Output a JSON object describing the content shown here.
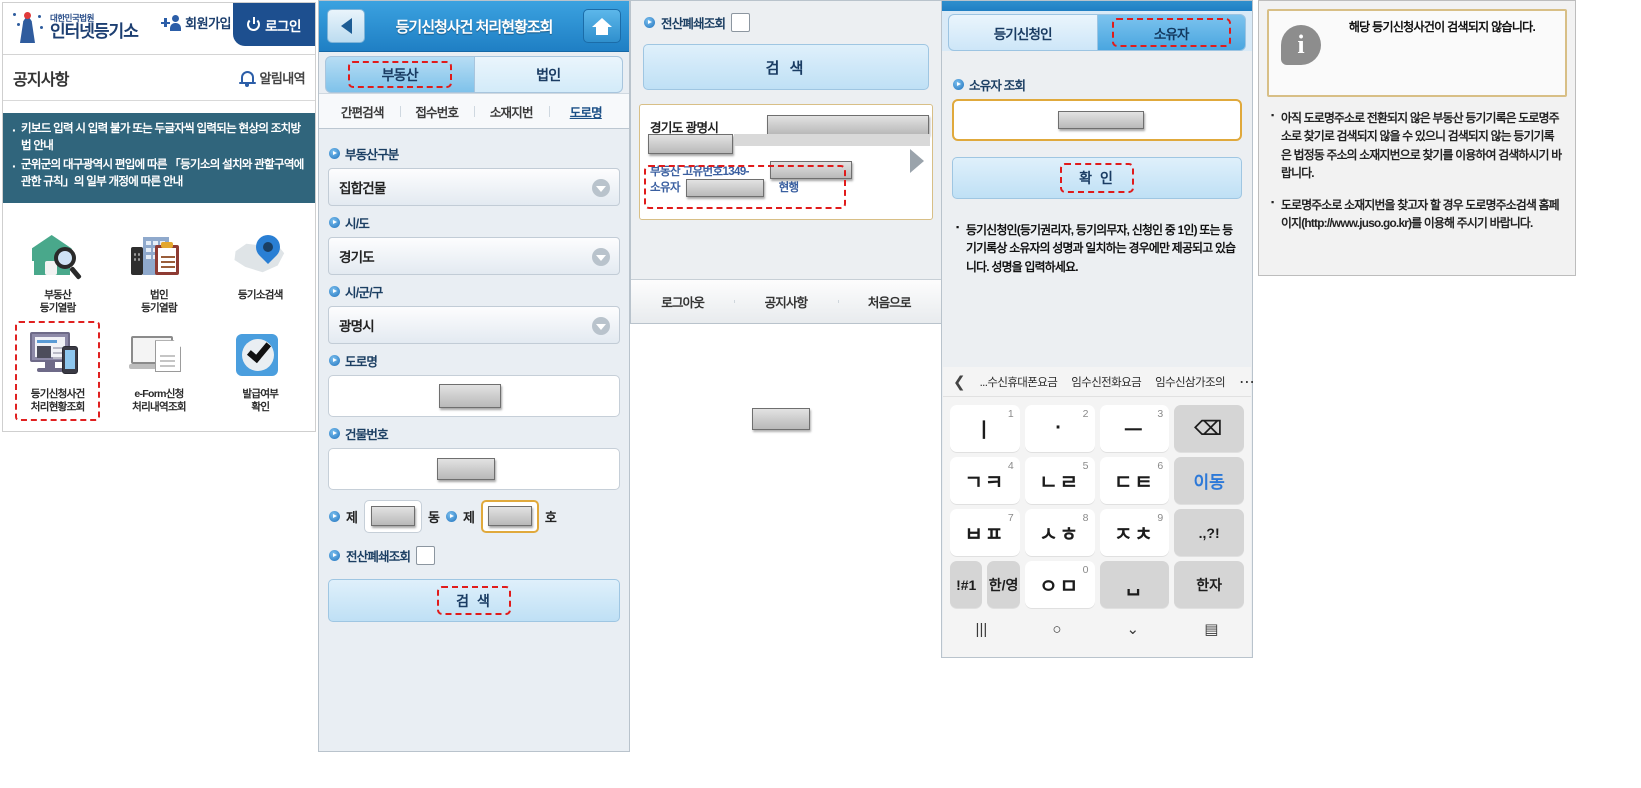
{
  "home": {
    "logo": {
      "line1": "대한민국법원",
      "line2": "인터넷등기소"
    },
    "join_label": "회원가입",
    "login_label": "로그인",
    "notice_title": "공지사항",
    "alarm_label": "알림내역",
    "notices": [
      "키보드 입력 시 입력 불가 또는 두글자씩 입력되는 현상의 조치방법 안내",
      "군위군의 대구광역시 편입에 따른 「등기소의 설치와 관할구역에 관한 규칙」의 일부 개정에 따른 안내"
    ],
    "menu": [
      {
        "label": "부동산\n등기열람",
        "icon": "house-search-icon",
        "highlight": false
      },
      {
        "label": "법인\n등기열람",
        "icon": "building-clipboard-icon",
        "highlight": false
      },
      {
        "label": "등기소검색",
        "icon": "map-pin-icon",
        "highlight": false
      },
      {
        "label": "등기신청사건\n처리현황조회",
        "icon": "desktop-mobile-icon",
        "highlight": true
      },
      {
        "label": "e-Form신청\n처리내역조회",
        "icon": "laptop-document-icon",
        "highlight": false
      },
      {
        "label": "발급여부\n확인",
        "icon": "check-badge-icon",
        "highlight": false
      }
    ]
  },
  "form": {
    "header_title": "등기신청사건 처리현황조회",
    "back_icon": "back-chevron-icon",
    "home_icon": "home-icon",
    "tabs": [
      {
        "label": "부동산",
        "active": true,
        "highlight": true
      },
      {
        "label": "법인",
        "active": false,
        "highlight": false
      }
    ],
    "subtabs": [
      {
        "label": "간편검색",
        "active": false
      },
      {
        "label": "접수번호",
        "active": false
      },
      {
        "label": "소재지번",
        "active": false
      },
      {
        "label": "도로명",
        "active": true
      }
    ],
    "fields": [
      {
        "label": "부동산구분",
        "value": "집합건물",
        "kind": "select"
      },
      {
        "label": "시/도",
        "value": "경기도",
        "kind": "select"
      },
      {
        "label": "시/군/구",
        "value": "광명시",
        "kind": "select"
      },
      {
        "label": "도로명",
        "value": "",
        "kind": "text",
        "redacted": true
      },
      {
        "label": "건물번호",
        "value": "",
        "kind": "text",
        "redacted": true
      }
    ],
    "dong_prefix": "제",
    "dong_suffix": "동",
    "ho_prefix": "제",
    "ho_suffix": "호",
    "closed_label": "전산폐쇄조회",
    "search_label": "검 색"
  },
  "results": {
    "closed_label": "전산폐쇄조회",
    "search_label": "검 색",
    "card": {
      "address_prefix": "경기도 광명시",
      "unique_no_label": "부동산 고유번호",
      "unique_no_value": "1349-",
      "owner_label": "소유자",
      "status_text": "현행",
      "arrow_icon": "chevron-right-icon"
    },
    "footer": [
      "로그아웃",
      "공지사항",
      "처음으로"
    ]
  },
  "owner": {
    "tabs": [
      {
        "label": "등기신청인",
        "active": false,
        "highlight": false
      },
      {
        "label": "소유자",
        "active": true,
        "highlight": true
      }
    ],
    "section_label": "소유자 조회",
    "input_value": "",
    "confirm_label": "확 인",
    "help_text": "등기신청인(등기권리자, 등기의무자, 신청인 중 1인) 또는 등기기록상 소유자의 성명과 일치하는 경우에만 제공되고 있습니다. 성명을 입력하세요.",
    "keyboard": {
      "back_icon": "suggest-back-chevron-icon",
      "more_icon": "suggest-more-icon",
      "suggestions": [
        "...수신휴대폰요금",
        "임수신전화요금",
        "임수신삼가조의"
      ],
      "keys": [
        {
          "main": "ㅣ",
          "num": "1",
          "type": "white"
        },
        {
          "main": "·",
          "num": "2",
          "type": "white"
        },
        {
          "main": "ㅡ",
          "num": "3",
          "type": "white"
        },
        {
          "main": "⌫",
          "num": "",
          "type": "grey",
          "name": "backspace-key"
        },
        {
          "main": "ㄱㅋ",
          "num": "4",
          "type": "white"
        },
        {
          "main": "ㄴㄹ",
          "num": "5",
          "type": "white"
        },
        {
          "main": "ㄷㅌ",
          "num": "6",
          "type": "white"
        },
        {
          "main": "이동",
          "num": "",
          "type": "blue",
          "name": "move-key"
        },
        {
          "main": "ㅂㅍ",
          "num": "7",
          "type": "white"
        },
        {
          "main": "ㅅㅎ",
          "num": "8",
          "type": "white"
        },
        {
          "main": "ㅈㅊ",
          "num": "9",
          "type": "white"
        },
        {
          "main": ".,?!",
          "num": "",
          "type": "grey",
          "name": "punctuation-key"
        },
        {
          "main": "!#1",
          "num": "",
          "type": "grey",
          "name": "symbols-key"
        },
        {
          "main": "한/영",
          "num": "",
          "type": "grey",
          "name": "language-key"
        },
        {
          "main": "ㅇㅁ",
          "num": "0",
          "type": "white"
        },
        {
          "main": "␣",
          "num": "",
          "type": "grey",
          "name": "space-key"
        },
        {
          "main": "한자",
          "num": "",
          "type": "grey",
          "name": "hanja-key"
        }
      ],
      "nav": [
        "|||",
        "○",
        "⌄",
        "▤"
      ]
    }
  },
  "notice_panel": {
    "info_icon": "info-icon",
    "message": "해당 등기신청사건이 검색되지 않습니다.",
    "items": [
      "아직 도로명주소로 전환되지 않은 부동산 등기기록은 도로명주소로 찾기로 검색되지 않을 수 있으니 검색되지 않는 등기기록은 법정동 주소의 소재지번으로 찾기를 이용하여 검색하시기 바랍니다.",
      "도로명주소로 소재지번을 찾고자 할 경우 도로명주소검색 홈페이지(http://www.juso.go.kr)를 이용해 주시기 바랍니다."
    ]
  }
}
